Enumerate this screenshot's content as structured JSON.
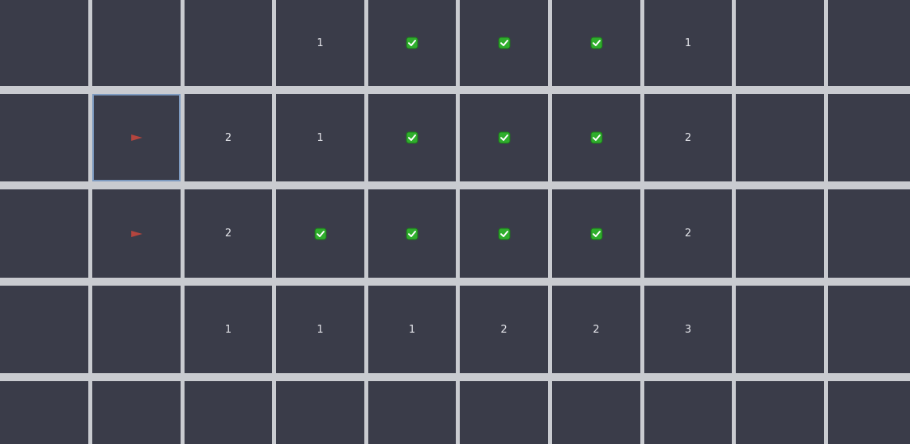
{
  "board": {
    "rows": [
      [
        {
          "type": "empty"
        },
        {
          "type": "empty"
        },
        {
          "type": "empty"
        },
        {
          "type": "number",
          "value": "1"
        },
        {
          "type": "check",
          "icon": "checkmark-icon"
        },
        {
          "type": "check",
          "icon": "checkmark-icon"
        },
        {
          "type": "check",
          "icon": "checkmark-icon"
        },
        {
          "type": "number",
          "value": "1"
        },
        {
          "type": "empty"
        },
        {
          "type": "empty"
        }
      ],
      [
        {
          "type": "empty"
        },
        {
          "type": "flag",
          "icon": "flag-icon",
          "selected": true
        },
        {
          "type": "number",
          "value": "2"
        },
        {
          "type": "number",
          "value": "1"
        },
        {
          "type": "check",
          "icon": "checkmark-icon"
        },
        {
          "type": "check",
          "icon": "checkmark-icon"
        },
        {
          "type": "check",
          "icon": "checkmark-icon"
        },
        {
          "type": "number",
          "value": "2"
        },
        {
          "type": "empty"
        },
        {
          "type": "empty"
        }
      ],
      [
        {
          "type": "empty"
        },
        {
          "type": "flag",
          "icon": "flag-icon"
        },
        {
          "type": "number",
          "value": "2"
        },
        {
          "type": "check",
          "icon": "checkmark-icon"
        },
        {
          "type": "check",
          "icon": "checkmark-icon"
        },
        {
          "type": "check",
          "icon": "checkmark-icon"
        },
        {
          "type": "check",
          "icon": "checkmark-icon"
        },
        {
          "type": "number",
          "value": "2"
        },
        {
          "type": "empty"
        },
        {
          "type": "empty"
        }
      ],
      [
        {
          "type": "empty"
        },
        {
          "type": "empty"
        },
        {
          "type": "number",
          "value": "1"
        },
        {
          "type": "number",
          "value": "1"
        },
        {
          "type": "number",
          "value": "1"
        },
        {
          "type": "number",
          "value": "2"
        },
        {
          "type": "number",
          "value": "2"
        },
        {
          "type": "number",
          "value": "3"
        },
        {
          "type": "empty"
        },
        {
          "type": "empty"
        }
      ],
      [
        {
          "type": "empty"
        },
        {
          "type": "empty"
        },
        {
          "type": "empty"
        },
        {
          "type": "empty"
        },
        {
          "type": "empty"
        },
        {
          "type": "empty"
        },
        {
          "type": "empty"
        },
        {
          "type": "empty"
        },
        {
          "type": "empty"
        },
        {
          "type": "empty"
        }
      ]
    ]
  },
  "colors": {
    "cell_background": "#3a3c49",
    "grid_lines": "#c9cbd0",
    "number_text": "#e4e5ea",
    "check_green": "#2fae2c",
    "flag_red": "#b4453e",
    "selection_outline": "#7d9ac0"
  }
}
